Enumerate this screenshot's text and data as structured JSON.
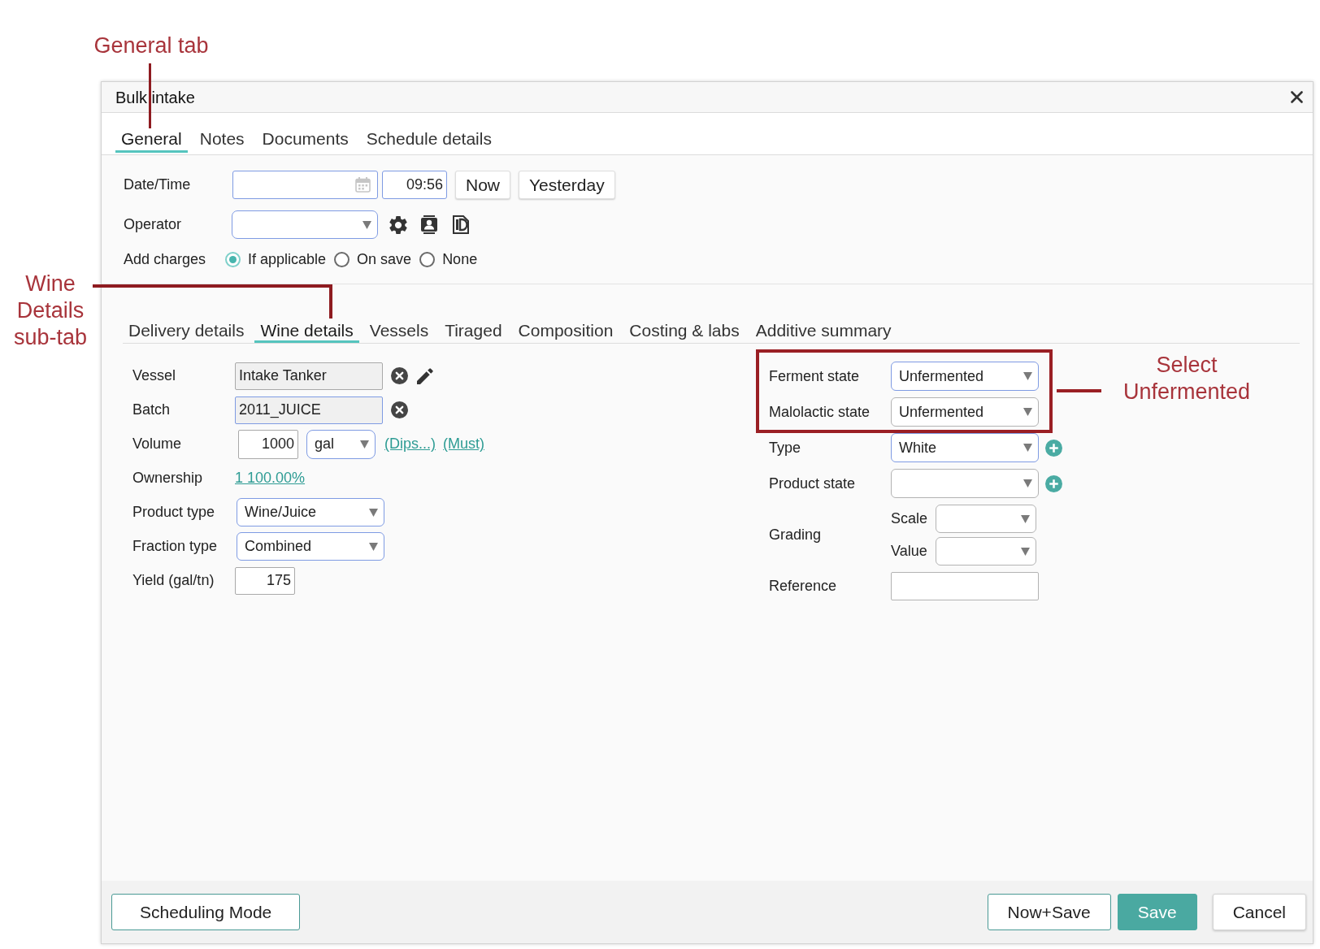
{
  "annotations": [
    {
      "text": "General tab"
    },
    {
      "text": "Wine Details sub-tab"
    },
    {
      "text": "Select Unfermented"
    }
  ],
  "dialog": {
    "title": "Bulk intake"
  },
  "tabs": [
    {
      "label": "General",
      "selected": true
    },
    {
      "label": "Notes",
      "selected": false
    },
    {
      "label": "Documents",
      "selected": false
    },
    {
      "label": "Schedule details",
      "selected": false
    }
  ],
  "general": {
    "date_time": {
      "label": "Date/Time",
      "time": "09:56",
      "buttons": [
        "Now",
        "Yesterday"
      ]
    },
    "operator": {
      "label": "Operator"
    },
    "add_charges": {
      "label": "Add charges",
      "options": [
        {
          "label": "If applicable",
          "selected": true
        },
        {
          "label": "On save",
          "selected": false
        },
        {
          "label": "None",
          "selected": false
        }
      ]
    }
  },
  "sub_tabs": [
    {
      "label": "Delivery details",
      "selected": false
    },
    {
      "label": "Wine details",
      "selected": true
    },
    {
      "label": "Vessels",
      "selected": false
    },
    {
      "label": "Tiraged",
      "selected": false
    },
    {
      "label": "Composition",
      "selected": false
    },
    {
      "label": "Costing & labs",
      "selected": false
    },
    {
      "label": "Additive summary",
      "selected": false
    }
  ],
  "wine_details": {
    "left": [
      {
        "kind": "picker",
        "label": "Vessel",
        "value": "Intake Tanker",
        "highlighted": false,
        "edit_button": true
      },
      {
        "kind": "picker",
        "label": "Batch",
        "value": "2011_JUICE",
        "highlighted": true,
        "edit_button": false
      },
      {
        "kind": "volume",
        "label": "Volume",
        "value": "1000",
        "unit": "gal",
        "links": [
          "(Dips...)",
          "(Must)"
        ]
      },
      {
        "kind": "link",
        "label": "Ownership",
        "value": "1 100.00%"
      },
      {
        "kind": "select",
        "label": "Product type",
        "value": "Wine/Juice",
        "highlighted": true
      },
      {
        "kind": "select",
        "label": "Fraction type",
        "value": "Combined",
        "highlighted": true
      },
      {
        "kind": "number",
        "label": "Yield (gal/tn)",
        "value": "175"
      }
    ],
    "right": [
      {
        "kind": "select",
        "label": "Ferment state",
        "value": "Unfermented",
        "highlighted": true,
        "add_button": false
      },
      {
        "kind": "select",
        "label": "Malolactic state",
        "value": "Unfermented",
        "highlighted": false,
        "add_button": false
      },
      {
        "kind": "select",
        "label": "Type",
        "value": "White",
        "highlighted": true,
        "add_button": true
      },
      {
        "kind": "select",
        "label": "Product state",
        "highlighted": false,
        "add_button": true
      },
      {
        "kind": "grading",
        "label": "Grading",
        "parts": [
          {
            "label": "Scale"
          },
          {
            "label": "Value"
          }
        ]
      },
      {
        "kind": "text",
        "label": "Reference"
      }
    ]
  },
  "footer": {
    "left_buttons": [
      {
        "label": "Scheduling Mode",
        "kind": "outline"
      }
    ],
    "right_buttons": [
      {
        "label": "Now+Save",
        "kind": "outline"
      },
      {
        "label": "Save",
        "kind": "primary"
      },
      {
        "label": "Cancel",
        "kind": "plain"
      }
    ]
  }
}
